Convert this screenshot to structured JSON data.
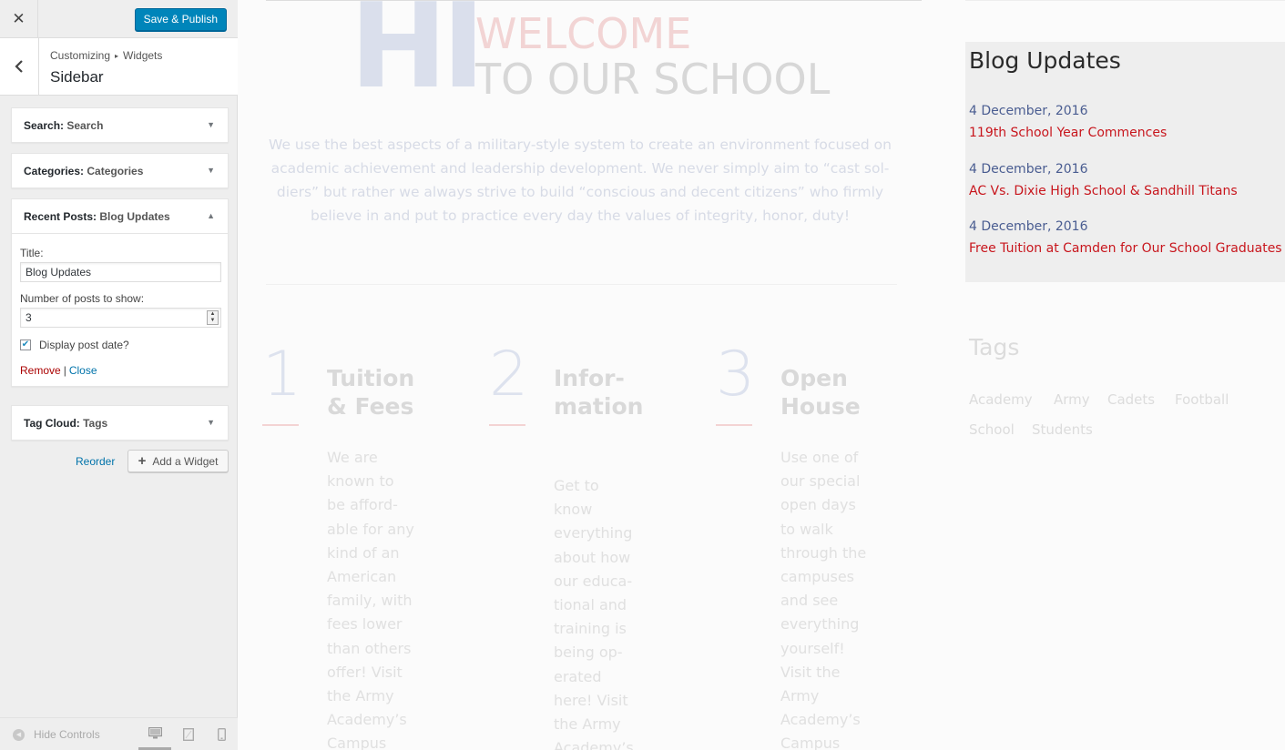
{
  "customizer": {
    "close_glyph": "✕",
    "save_label": "Save & Publish",
    "breadcrumb": {
      "root": "Customizing",
      "separator": "▸",
      "parent": "Widgets"
    },
    "section_title": "Sidebar",
    "widgets": [
      {
        "type": "Search:",
        "title": "Search",
        "expanded": false
      },
      {
        "type": "Categories:",
        "title": "Categories",
        "expanded": false
      },
      {
        "type": "Recent Posts:",
        "title": "Blog Updates",
        "expanded": true
      },
      {
        "type": "Tag Cloud:",
        "title": "Tags",
        "expanded": false
      }
    ],
    "recent_posts_form": {
      "title_label": "Title:",
      "title_value": "Blog Updates",
      "number_label": "Number of posts to show:",
      "number_value": "3",
      "display_date_label": "Display post date?",
      "display_date_checked": true,
      "remove_label": "Remove",
      "separator": "|",
      "close_label": "Close"
    },
    "reorder_label": "Reorder",
    "add_widget_label": "Add a Widget",
    "footer": {
      "hide_controls_label": "Hide Controls",
      "devices": [
        "desktop-icon",
        "tablet-icon",
        "mobile-icon"
      ],
      "active_device": "desktop"
    }
  },
  "preview": {
    "hero": {
      "big": "HI",
      "line1": "WELCOME",
      "line2": "TO OUR SCHOOL",
      "body": "We use the best aspects of a military-style system to create an environment focused on academic achievement and leadership development. We never simply aim to “cast sol­diers” but rather we always strive to build “conscious and decent citizens” who firmly be­lieve in and put to practice every day the values of integrity, honor, duty!"
    },
    "features": [
      {
        "num": "1",
        "title": "Tuition & Fees",
        "body": "We are known to be afford­able for any kind of an Ameri­can family, with fees lower than others of­fer! Visit the Army Academy’s Campus"
      },
      {
        "num": "2",
        "title": "Infor­ma­tion",
        "body": "Get to know everything about how our educa­tional and training is being op­erated here! Visit the Army Academy’s Campus"
      },
      {
        "num": "3",
        "title": "Open House",
        "body": "Use one of our special open days to walk through the campuses and see everything yourself! Visit the Army Academy’s Campus"
      }
    ],
    "blog": {
      "title": "Blog Updates",
      "posts": [
        {
          "date": "4 December, 2016",
          "title": "119th School Year Commences"
        },
        {
          "date": "4 December, 2016",
          "title": "AC Vs. Dixie High School & Sandhill Titans"
        },
        {
          "date": "4 December, 2016",
          "title": "Free Tuition at Camden for Our School Graduates"
        }
      ]
    },
    "tags": {
      "title": "Tags",
      "items": [
        "Academy",
        "Army",
        "Cadets",
        "Football",
        "School",
        "Students"
      ]
    }
  },
  "colors": {
    "save_button": "#0085ba",
    "link": "#0073aa",
    "remove_link": "#aa0000",
    "post_date": "#4a5d91",
    "post_title": "#c8161d"
  }
}
